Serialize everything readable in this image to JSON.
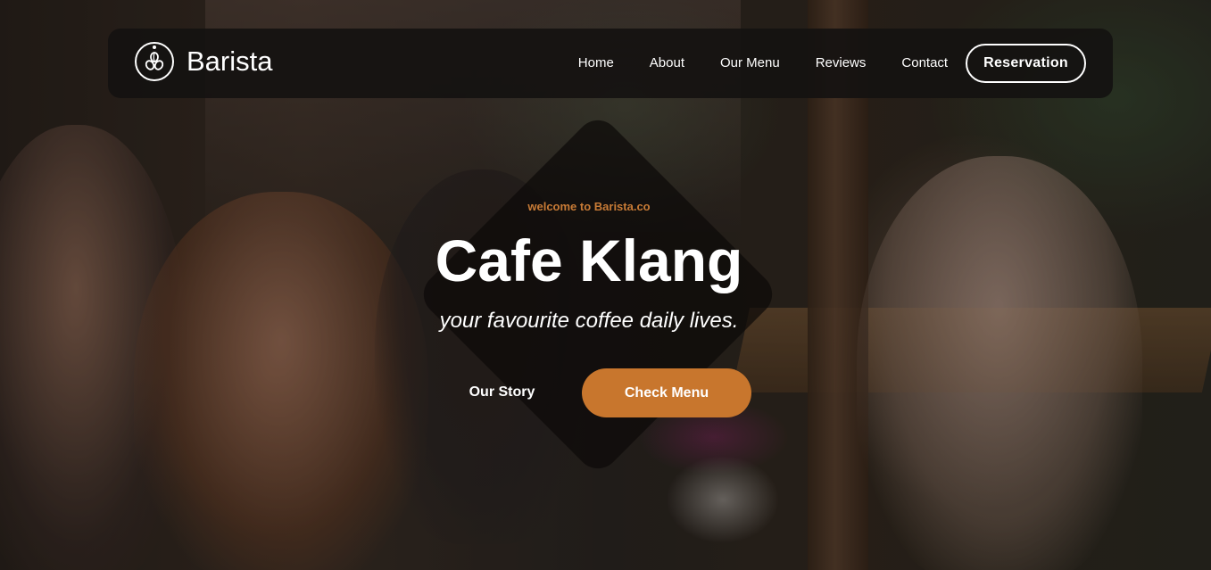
{
  "brand": {
    "name": "Barista",
    "logo_icon": "coffee-beans-logo-icon"
  },
  "nav": {
    "links": [
      "Home",
      "About",
      "Our Menu",
      "Reviews",
      "Contact"
    ],
    "reservation_label": "Reservation"
  },
  "hero": {
    "tagline": "welcome to Barista.co",
    "title": "Cafe Klang",
    "subtitle": "your favourite coffee daily lives.",
    "story_label": "Our Story",
    "menu_label": "Check Menu"
  },
  "colors": {
    "accent": "#c8762d",
    "tagline": "#c87b36",
    "navbar_bg": "#141211"
  }
}
